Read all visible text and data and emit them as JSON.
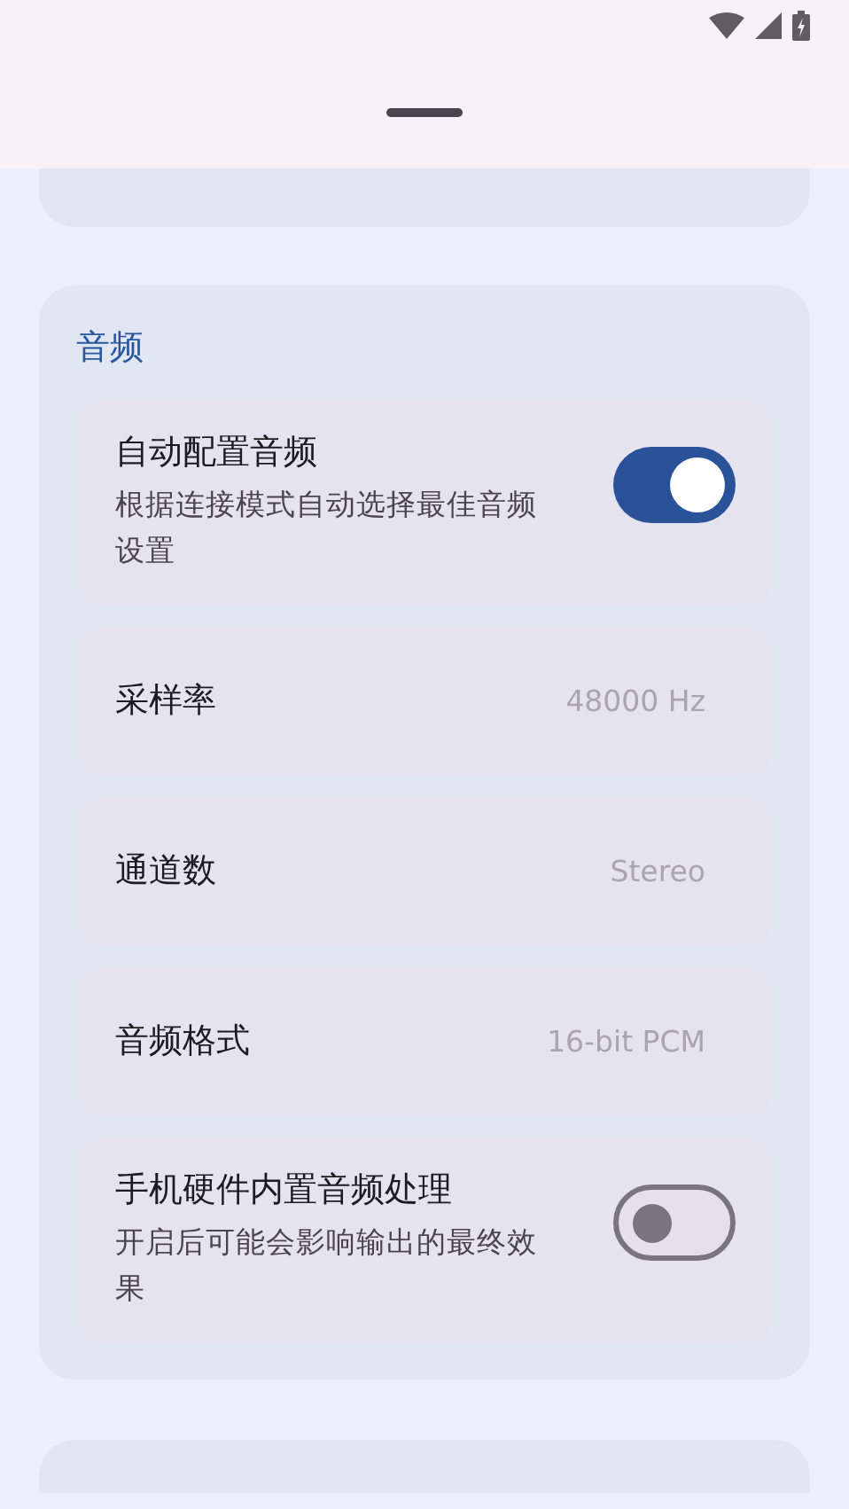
{
  "section": {
    "title": "音频"
  },
  "rows": [
    {
      "kind": "switch",
      "label": "自动配置音频",
      "description": "根据连接模式自动选择最佳音频设置",
      "on": true
    },
    {
      "kind": "value",
      "label": "采样率",
      "value": "48000 Hz"
    },
    {
      "kind": "value",
      "label": "通道数",
      "value": "Stereo"
    },
    {
      "kind": "value",
      "label": "音频格式",
      "value": "16-bit PCM"
    },
    {
      "kind": "switch",
      "label": "手机硬件内置音频处理",
      "description": "开启后可能会影响输出的最终效果",
      "on": false
    }
  ]
}
